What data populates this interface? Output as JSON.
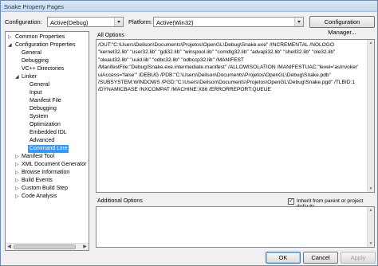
{
  "window": {
    "title": "Snake Property Pages"
  },
  "header": {
    "configuration_label": "Configuration:",
    "configuration_value": "Active(Debug)",
    "platform_label": "Platform:",
    "platform_value": "Active(Win32)",
    "config_manager_label": "Configuration Manager..."
  },
  "tree": {
    "common_properties": "Common Properties",
    "configuration_properties": "Configuration Properties",
    "general": "General",
    "debugging": "Debugging",
    "vc_directories": "VC++ Directories",
    "linker": "Linker",
    "linker_items": [
      "General",
      "Input",
      "Manifest File",
      "Debugging",
      "System",
      "Optimization",
      "Embedded IDL",
      "Advanced",
      "Command Line"
    ],
    "manifest_tool": "Manifest Tool",
    "xml_doc_gen": "XML Document Generator",
    "browse_info": "Browse Information",
    "build_events": "Build Events",
    "custom_build": "Custom Build Step",
    "code_analysis": "Code Analysis"
  },
  "all_options": {
    "label": "All Options",
    "text": "/OUT:\"C:\\Users\\Deilson\\Documents\\Projetos\\OpenGL\\Debug\\Snake.exe\" /INCREMENTAL /NOLOGO \"kernel32.lib\" \"user32.lib\" \"gdi32.lib\" \"winspool.lib\" \"comdlg32.lib\" \"advapi32.lib\" \"shell32.lib\" \"ole32.lib\" \"oleaut32.lib\" \"uuid.lib\" \"odbc32.lib\" \"odbccp32.lib\" /MANIFEST /ManifestFile:\"Debug\\Snake.exe.intermediate.manifest\" /ALLOWISOLATION /MANIFESTUAC:\"level='asInvoker' uiAccess='false'\" /DEBUG /PDB:\"C:\\Users\\Deilson\\Documents\\Projetos\\OpenGL\\Debug\\Snake.pdb\" /SUBSYSTEM:WINDOWS /PGD:\"C:\\Users\\Deilson\\Documents\\Projetos\\OpenGL\\Debug\\Snake.pgd\" /TLBID:1 /DYNAMICBASE /NXCOMPAT /MACHINE:X86 /ERRORREPORT:QUEUE"
  },
  "additional_options": {
    "label": "Additional Options",
    "inherit_label": "Inherit from parent or project defaults",
    "inherit_checked": true,
    "value": ""
  },
  "buttons": {
    "ok": "OK",
    "cancel": "Cancel",
    "apply": "Apply"
  },
  "icons": {
    "expanded": "expand-collapsed-arrow",
    "collapsed": "expand-arrow"
  },
  "colors": {
    "selection": "#3399ff",
    "background": "#f0f0f0"
  }
}
